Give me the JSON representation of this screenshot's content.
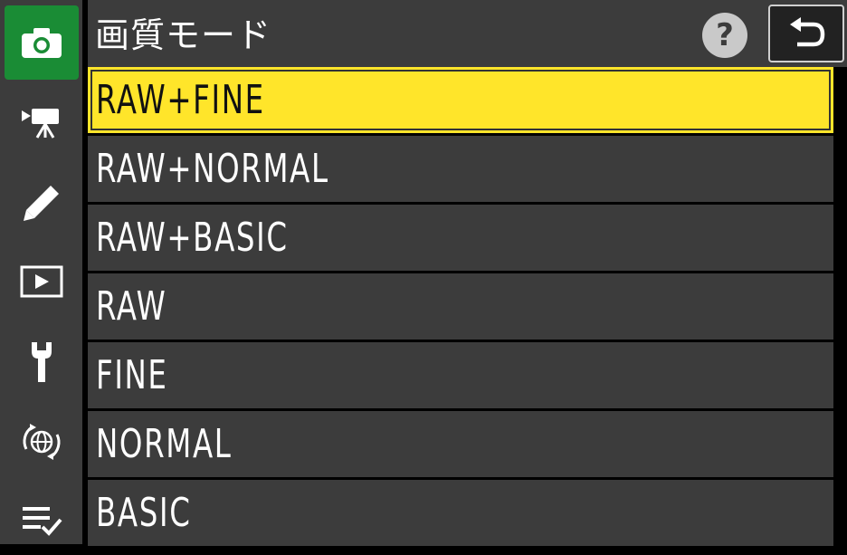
{
  "header": {
    "title": "画質モード",
    "help_label": "?"
  },
  "sidebar": {
    "items": [
      {
        "icon": "camera-icon",
        "active": true
      },
      {
        "icon": "movie-camera-icon",
        "active": false
      },
      {
        "icon": "pencil-icon",
        "active": false
      },
      {
        "icon": "playback-icon",
        "active": false
      },
      {
        "icon": "wrench-icon",
        "active": false
      },
      {
        "icon": "network-icon",
        "active": false
      },
      {
        "icon": "my-menu-icon",
        "active": false
      }
    ]
  },
  "list": {
    "items": [
      {
        "label": "RAW+FINE",
        "selected": true
      },
      {
        "label": "RAW+NORMAL",
        "selected": false
      },
      {
        "label": "RAW+BASIC",
        "selected": false
      },
      {
        "label": "RAW",
        "selected": false
      },
      {
        "label": "FINE",
        "selected": false
      },
      {
        "label": "NORMAL",
        "selected": false
      },
      {
        "label": "BASIC",
        "selected": false
      }
    ]
  },
  "colors": {
    "accent_green": "#1a8c35",
    "highlight_yellow": "#ffe52a",
    "panel_gray": "#3c3c3c"
  }
}
